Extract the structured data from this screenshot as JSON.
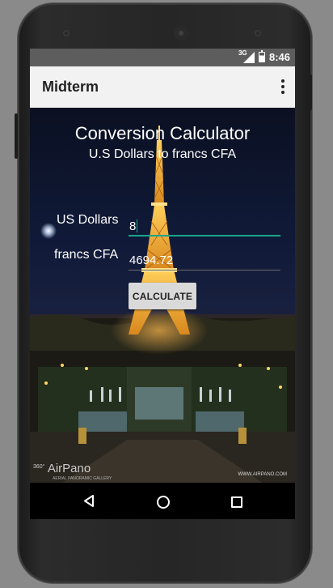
{
  "status_bar": {
    "network_label": "3G",
    "time": "8:46",
    "icons": [
      "signal-icon",
      "battery-icon"
    ]
  },
  "app_bar": {
    "title": "Midterm",
    "menu_icon": "overflow-menu-icon"
  },
  "calculator": {
    "title": "Conversion Calculator",
    "subtitle": "U.S Dollars to francs CFA",
    "usd_label": "US Dollars",
    "usd_value": "8",
    "cfa_label": "francs CFA",
    "cfa_value": "4694.72",
    "button_label": "CALCULATE"
  },
  "background_image": {
    "watermark_brand": "AirPano",
    "watermark_prefix": "360°",
    "watermark_sub": "AERIAL PANORAMIC GALLERY",
    "site": "WWW.AIRPANO.COM"
  },
  "nav_bar": {
    "icons": [
      "back-icon",
      "home-icon",
      "recents-icon"
    ]
  },
  "colors": {
    "accent": "#19a68c",
    "app_bar_bg": "#f2f2f2",
    "status_bar_bg": "#5d5d5d",
    "button_bg": "#d9d9d9"
  }
}
